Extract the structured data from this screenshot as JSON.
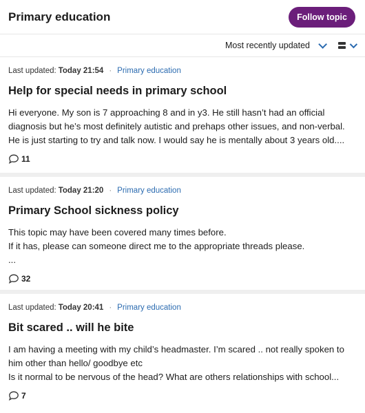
{
  "header": {
    "title": "Primary education",
    "follow_label": "Follow topic"
  },
  "sortbar": {
    "sort_label": "Most recently updated"
  },
  "threads": [
    {
      "updated_prefix": "Last updated:",
      "updated_time": "Today 21:54",
      "category": "Primary education",
      "title": "Help for special needs in primary school",
      "excerpt_lines": [
        "Hi everyone. My son is 7 approaching 8 and in y3. He still hasn’t had an official",
        "diagnosis but he’s most definitely autistic and prehaps other issues, and non-verbal.",
        "He is just starting to try and talk now. I would say he is mentally about 3 years old...."
      ],
      "reply_count": "11"
    },
    {
      "updated_prefix": "Last updated:",
      "updated_time": "Today 21:20",
      "category": "Primary education",
      "title": "Primary School sickness policy",
      "excerpt_lines": [
        "This topic may have been covered many times before.",
        "If it has, please can someone direct me to the appropriate threads please.",
        "..."
      ],
      "reply_count": "32"
    },
    {
      "updated_prefix": "Last updated:",
      "updated_time": "Today 20:41",
      "category": "Primary education",
      "title": "Bit scared .. will he bite",
      "excerpt_lines": [
        "I am having a meeting with my child’s headmaster. I’m scared .. not really spoken to",
        "him other than hello/ goodbye etc",
        "Is it normal to be nervous of the head? What are others relationships with school..."
      ],
      "reply_count": "7"
    }
  ]
}
